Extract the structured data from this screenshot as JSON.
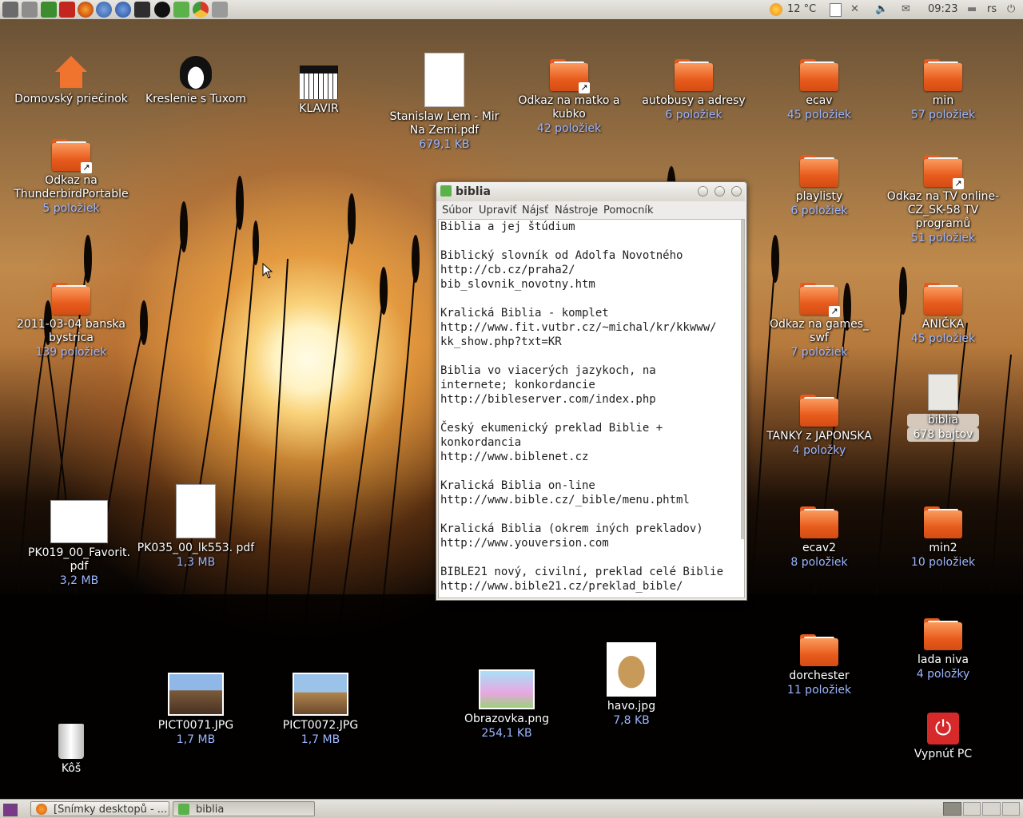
{
  "top_panel": {
    "weather": "12 °C",
    "clock": "09:23",
    "user": "rs"
  },
  "taskbar": {
    "items": [
      {
        "label": "[Snímky desktopů - ..."
      },
      {
        "label": "biblia"
      }
    ]
  },
  "desktop_icons": {
    "home": {
      "label": "Domovský priečinok"
    },
    "tux": {
      "label": "Kreslenie s Tuxom"
    },
    "klavir": {
      "label": "KLAVIR"
    },
    "lem": {
      "label": "Stanislaw Lem - Mir Na Zemi.pdf",
      "sub": "679,1 KB"
    },
    "matko": {
      "label": "Odkaz na matko a kubko",
      "sub": "42 položiek"
    },
    "autobusy": {
      "label": "autobusy a adresy",
      "sub": "6 položiek"
    },
    "ecav": {
      "label": "ecav",
      "sub": "45 položiek"
    },
    "min": {
      "label": "min",
      "sub": "57 položiek"
    },
    "thunderbird": {
      "label": "Odkaz na ThunderbirdPortable",
      "sub": "5 položiek"
    },
    "playlisty": {
      "label": "playlisty",
      "sub": "6 položiek"
    },
    "tv_online": {
      "label": "Odkaz na TV online- CZ_SK-58 TV programů",
      "sub": "51 položiek"
    },
    "banska": {
      "label": "2011-03-04 banska bystrica",
      "sub": "139 položiek"
    },
    "games": {
      "label": "Odkaz na games_ swf",
      "sub": "7 položiek"
    },
    "anicka": {
      "label": "ANIČKA",
      "sub": "45 položiek"
    },
    "biblia": {
      "label": "biblia",
      "sub": "678 bajtov"
    },
    "tanky": {
      "label": "TANKY z JAPONSKA",
      "sub": "4 položky"
    },
    "pk019": {
      "label": "PK019_00_Favorit. pdf",
      "sub": "3,2 MB"
    },
    "pk035": {
      "label": "PK035_00_lk553. pdf",
      "sub": "1,3 MB"
    },
    "ecav2": {
      "label": "ecav2",
      "sub": "8 položiek"
    },
    "min2": {
      "label": "min2",
      "sub": "10 položiek"
    },
    "dorchester": {
      "label": "dorchester",
      "sub": "11 položiek"
    },
    "lada": {
      "label": "lada niva",
      "sub": "4 položky"
    },
    "pict71": {
      "label": "PICT0071.JPG",
      "sub": "1,7 MB"
    },
    "pict72": {
      "label": "PICT0072.JPG",
      "sub": "1,7 MB"
    },
    "obrazovka": {
      "label": "Obrazovka.png",
      "sub": "254,1 KB"
    },
    "havo": {
      "label": "havo.jpg",
      "sub": "7,8 KB"
    },
    "kos": {
      "label": "Kôš"
    },
    "vypnut": {
      "label": "Vypnúť PC"
    }
  },
  "gedit": {
    "title": "biblia",
    "menu": [
      "Súbor",
      "Upraviť",
      "Nájsť",
      "Nástroje",
      "Pomocník"
    ],
    "lines": [
      "Biblia a jej štúdium",
      "",
      "Biblický slovník od Adolfa Novotného",
      "http://cb.cz/praha2/",
      "bib_slovnik_novotny.htm",
      "",
      "Kralická Biblia - komplet",
      "http://www.fit.vutbr.cz/~michal/kr/kkwww/",
      "kk_show.php?txt=KR",
      "",
      "Biblia vo viacerých jazykoch, na",
      "internete; konkordancie",
      "http://bibleserver.com/index.php",
      "",
      "Český ekumenický preklad Biblie +",
      "konkordancia",
      "http://www.biblenet.cz",
      "",
      "Kralická Biblia on-line",
      "http://www.bible.cz/_bible/menu.phtml",
      "",
      "Kralická Biblia (okrem iných prekladov)",
      "http://www.youversion.com",
      "",
      "BIBLE21 nový, civilní, preklad celé Biblie",
      "http://www.bible21.cz/preklad_bible/"
    ]
  },
  "colors": {
    "folder": "#f0732e",
    "sublabel": "#9cb6ff",
    "panel": "#dcd9d2"
  }
}
